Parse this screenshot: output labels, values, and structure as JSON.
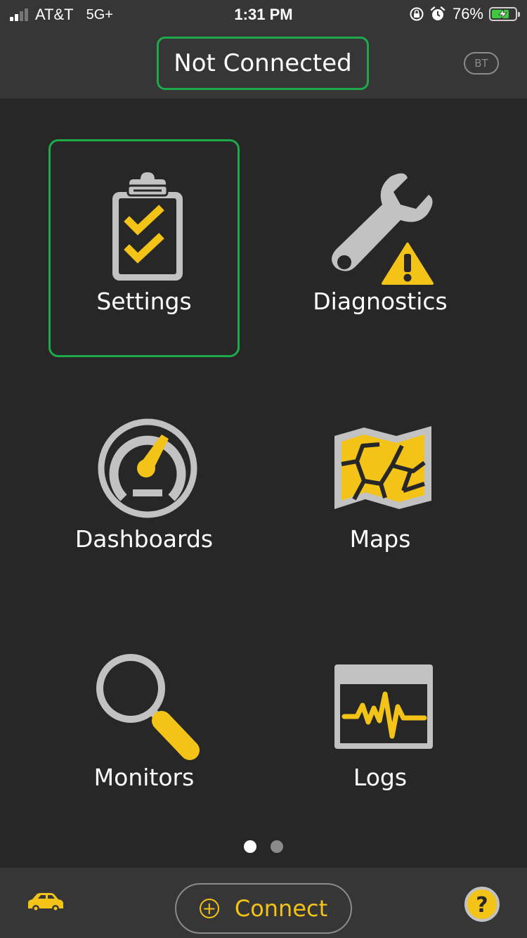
{
  "status_bar": {
    "carrier": "AT&T",
    "network": "5G+",
    "time": "1:31 PM",
    "battery_percent": "76%",
    "battery_level": 0.76,
    "icons": [
      "cellular-signal-icon",
      "orientation-lock-icon",
      "alarm-icon",
      "battery-charging-icon"
    ]
  },
  "header": {
    "connection_status": "Not Connected",
    "bt_label": "BT"
  },
  "menu": {
    "items": [
      {
        "label": "Settings",
        "icon": "clipboard-checklist-icon",
        "selected": true
      },
      {
        "label": "Diagnostics",
        "icon": "wrench-warning-icon",
        "selected": false
      },
      {
        "label": "Dashboards",
        "icon": "gauge-icon",
        "selected": false
      },
      {
        "label": "Maps",
        "icon": "map-icon",
        "selected": false
      },
      {
        "label": "Monitors",
        "icon": "magnifier-icon",
        "selected": false
      },
      {
        "label": "Logs",
        "icon": "log-waveform-icon",
        "selected": false
      }
    ]
  },
  "pager": {
    "pages": 2,
    "current": 1
  },
  "bottom_bar": {
    "connect_label": "Connect",
    "icons": [
      "car-icon",
      "plus-circle-icon",
      "help-icon"
    ]
  },
  "colors": {
    "background": "#272727",
    "bar": "#363636",
    "accent_yellow": "#f3c317",
    "selection_green": "#1eaa4a",
    "icon_gray": "#c2c2c2",
    "text": "#ffffff"
  }
}
